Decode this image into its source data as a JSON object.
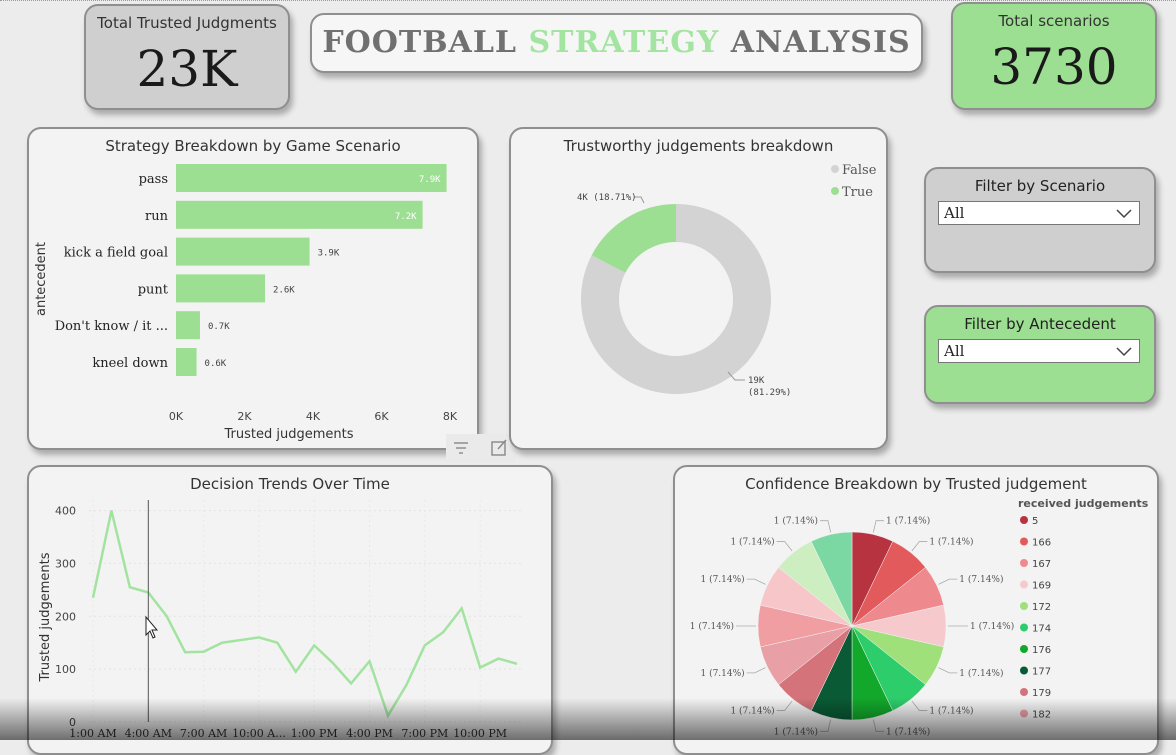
{
  "kpi": {
    "trusted": {
      "label": "Total Trusted Judgments",
      "value": "23K"
    },
    "scenarios": {
      "label": "Total scenarios",
      "value": "3730"
    }
  },
  "title": {
    "word1": "FOOTBALL",
    "word2": "STRATEGY",
    "word3": "ANALYSIS"
  },
  "colors": {
    "green": "#9ddf92",
    "gray_card": "#cfcfcf",
    "donut_false": "#d3d3d3",
    "title_gray": "#707070",
    "title_green": "#a3e4a0",
    "line": "#a3e3a0"
  },
  "filters": {
    "scenario": {
      "label": "Filter by Scenario",
      "value": "All",
      "icon": "chevron-down-icon"
    },
    "antecedent": {
      "label": "Filter by Antecedent",
      "value": "All",
      "icon": "chevron-down-icon"
    }
  },
  "visual_header": {
    "filter_icon": "filter-icon",
    "focus_icon": "focus-mode-icon"
  },
  "chart_data": [
    {
      "type": "bar",
      "title": "Strategy Breakdown by Game Scenario",
      "xlabel": "Trusted judgements",
      "ylabel": "antecedent",
      "categories": [
        "pass",
        "run",
        "kick a field goal",
        "punt",
        "Don't know / it ...",
        "kneel down"
      ],
      "values": [
        7900,
        7200,
        3900,
        2600,
        700,
        600
      ],
      "data_labels": [
        "7.9K",
        "7.2K",
        "3.9K",
        "2.6K",
        "0.7K",
        "0.6K"
      ],
      "xticks": [
        "0K",
        "2K",
        "4K",
        "6K",
        "8K"
      ],
      "xlim": [
        0,
        8000
      ]
    },
    {
      "type": "pie",
      "title": "Trustworthy judgements breakdown",
      "donut": true,
      "labels": [
        "False",
        "True"
      ],
      "values": [
        19000,
        4000
      ],
      "data_labels": [
        "19K (81.29%)",
        "4K (18.71%)"
      ],
      "legend_position": "top-right"
    },
    {
      "type": "line",
      "title": "Decision Trends Over Time",
      "ylabel": "Trusted judgements",
      "xticks": [
        "1:00 AM",
        "4:00 AM",
        "7:00 AM",
        "10:00 A...",
        "1:00 PM",
        "4:00 PM",
        "7:00 PM",
        "10:00 PM"
      ],
      "yticks": [
        "0",
        "100",
        "200",
        "300",
        "400"
      ],
      "ylim": [
        0,
        420
      ],
      "x": [
        0,
        1,
        2,
        3,
        4,
        5,
        6,
        7,
        8,
        9,
        10,
        11,
        12,
        13,
        14,
        15,
        16,
        17,
        18,
        19,
        20,
        21,
        22,
        23
      ],
      "values": [
        235,
        400,
        255,
        245,
        200,
        132,
        133,
        150,
        155,
        160,
        150,
        95,
        145,
        112,
        73,
        115,
        12,
        70,
        145,
        170,
        215,
        103,
        120,
        110
      ],
      "grid": true
    },
    {
      "type": "pie",
      "title": "Confidence Breakdown by Trusted judgement",
      "legend_title": "received judgements",
      "legend_position": "right",
      "labels": [
        "5",
        "166",
        "167",
        "169",
        "172",
        "174",
        "176",
        "177",
        "179",
        "182",
        "",
        "",
        "",
        ""
      ],
      "values": [
        1,
        1,
        1,
        1,
        1,
        1,
        1,
        1,
        1,
        1,
        1,
        1,
        1,
        1
      ],
      "slice_labels": [
        "1 (7.14%)",
        "1 (7.14%)",
        "1 (7.14%)",
        "1 (7.14%)",
        "1 (7.14%)",
        "1 (7.14%)",
        "1 (7.14%)",
        "1 (7.14%)",
        "1 (7.14%)",
        "1 (7.14%)",
        "1 (7.14%)",
        "1 (7.14%)",
        "1 (7.14%)",
        "1 (7.14%)"
      ],
      "colors": [
        "#b7333f",
        "#e35a5d",
        "#ee8a8e",
        "#f6c9cc",
        "#9fe07a",
        "#2ccd6a",
        "#12a82b",
        "#0a5a35",
        "#d4747a",
        "#e8a0a6",
        "#f09ea2",
        "#f7c6c9",
        "#cdeec0",
        "#7bd8a2"
      ]
    }
  ]
}
